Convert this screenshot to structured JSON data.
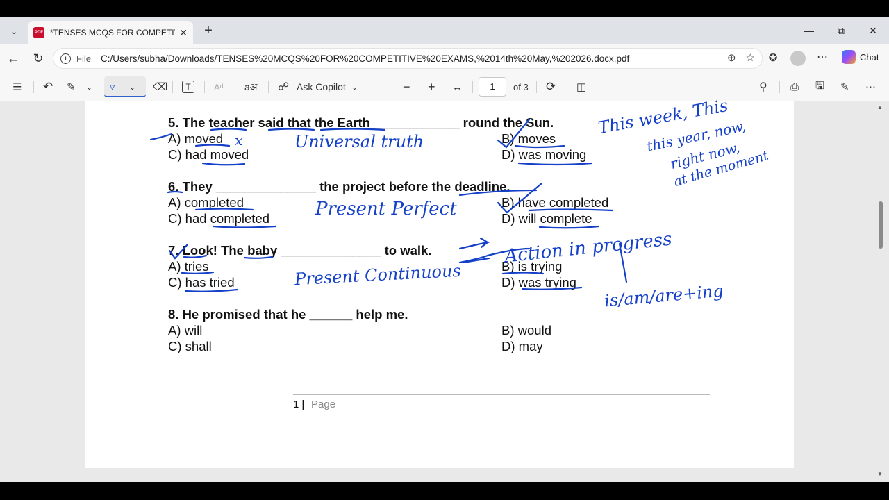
{
  "browser": {
    "tab_title": "*TENSES MCQS FOR COMPETITIVE EXAMS, 14th May, 2026.docx.pdf",
    "file_label": "File",
    "url": "C:/Users/subha/Downloads/TENSES%20MCQS%20FOR%20COMPETITIVE%20EXAMS,%2014th%20May,%202026.docx.pdf",
    "chat_label": "Chat",
    "icons": [
      "tab-actions-icon",
      "pdf-icon",
      "close-icon",
      "plus-icon",
      "minimize-icon",
      "restore-icon",
      "close-window-icon",
      "back-icon",
      "refresh-icon",
      "info-icon",
      "zoom-icon",
      "favorite-star-icon",
      "favorites-icon",
      "profile-icon",
      "more-icon",
      "copilot-icon"
    ]
  },
  "toolbar": {
    "ask_copilot": "Ask Copilot",
    "page_number": "1",
    "of_pages": "of 3",
    "icons": [
      "contents-icon",
      "undo-icon",
      "highlight-icon",
      "draw-icon",
      "eraser-icon",
      "text-icon",
      "text-size-icon",
      "read-aloud-icon",
      "copilot-icon",
      "zoom-out-icon",
      "zoom-in-icon",
      "fit-icon",
      "rotate-icon",
      "page-view-icon",
      "search-icon",
      "print-icon",
      "save-icon",
      "save-as-icon",
      "more-icon"
    ]
  },
  "document": {
    "questions": [
      {
        "q": "5. The teacher said that the Earth ____________ round the Sun.",
        "a": "A) moved",
        "b": "B) moves",
        "c": "C) had moved",
        "d": "D) was moving"
      },
      {
        "q": "6. They ______________ the project before the deadline.",
        "a": "A) completed",
        "b": "B) have completed",
        "c": "C) had completed",
        "d": "D) will complete"
      },
      {
        "q": "7. Look! The baby ______________ to walk.",
        "a": "A) tries",
        "b": "B) is trying",
        "c": "C) has tried",
        "d": "D) was trying"
      },
      {
        "q": "8. He promised that he ______ help me.",
        "a": "A) will",
        "b": "B) would",
        "c": "C) shall",
        "d": "D) may"
      }
    ],
    "footer_num": "1",
    "footer_sep": "|",
    "footer_page": "Page"
  },
  "annotations": {
    "universal_truth": "Universal truth",
    "this_week": "This week, This",
    "this_year": "this year, now,",
    "right_now": "right now,",
    "at_moment": "at the moment",
    "present_perfect": "Present Perfect",
    "action_in_progress": "Action in progress",
    "present_continuous": "Present Continuous",
    "is_am_are": "is/am/are+ing",
    "x_mark": "x"
  }
}
